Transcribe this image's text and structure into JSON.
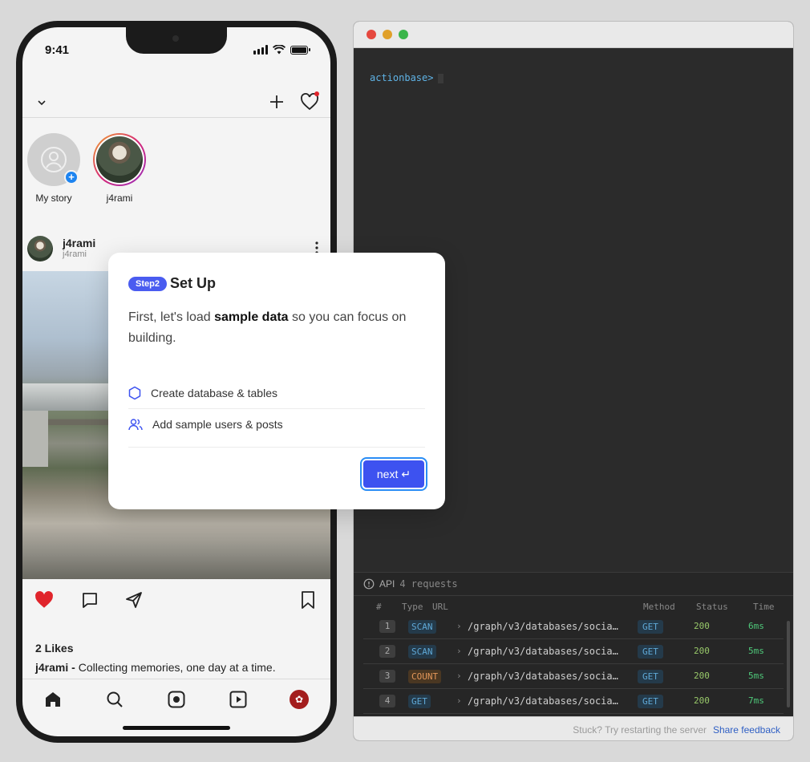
{
  "phone": {
    "status_time": "9:41",
    "stories": [
      {
        "label": "My story"
      },
      {
        "label": "j4rami"
      }
    ],
    "post": {
      "username": "j4rami",
      "subtitle": "j4rami",
      "likes": "2 Likes",
      "caption_user": "j4rami -",
      "caption_text": " Collecting memories, one day at a time."
    },
    "colors": {
      "like_red": "#e0242b",
      "story_plus_blue": "#1d84f0"
    }
  },
  "modal": {
    "step_badge": "Step2",
    "title": "Set Up",
    "desc_prefix": "First, let's load ",
    "desc_bold": "sample data",
    "desc_suffix": " so you can focus on building.",
    "tasks": [
      {
        "label": "Create database & tables",
        "icon": "hexagon-icon"
      },
      {
        "label": "Add sample users & posts",
        "icon": "users-icon"
      }
    ],
    "next_label": "next",
    "next_glyph": "↵",
    "accent": "#3d52f0"
  },
  "terminal": {
    "prompt": "actionbase>",
    "api": {
      "title": "API",
      "count": "4 requests",
      "columns": {
        "num": "#",
        "type": "Type",
        "url": "URL",
        "method": "Method",
        "status": "Status",
        "time": "Time"
      },
      "rows": [
        {
          "num": "1",
          "type": "SCAN",
          "url": "/graph/v3/databases/socia…",
          "method": "GET",
          "status": "200",
          "time": "6ms"
        },
        {
          "num": "2",
          "type": "SCAN",
          "url": "/graph/v3/databases/socia…",
          "method": "GET",
          "status": "200",
          "time": "5ms"
        },
        {
          "num": "3",
          "type": "COUNT",
          "url": "/graph/v3/databases/socia…",
          "method": "GET",
          "status": "200",
          "time": "5ms"
        },
        {
          "num": "4",
          "type": "GET",
          "url": "/graph/v3/databases/socia…",
          "method": "GET",
          "status": "200",
          "time": "7ms"
        }
      ]
    },
    "footer": {
      "hint": "Stuck? Try restarting the server",
      "link": "Share feedback"
    }
  }
}
